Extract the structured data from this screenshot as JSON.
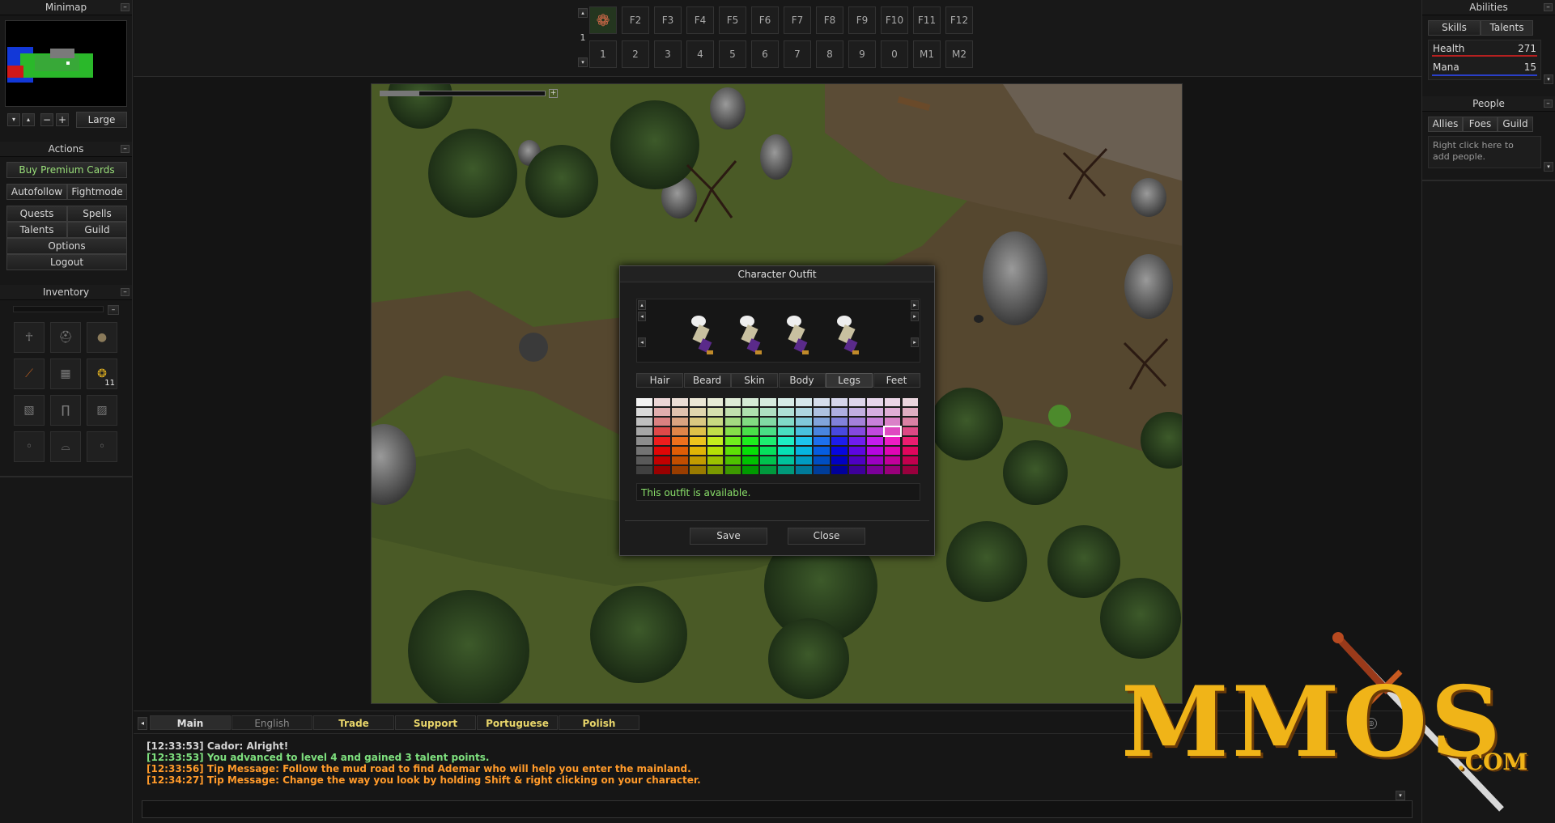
{
  "minimap": {
    "title": "Minimap",
    "size_label": "Large"
  },
  "actions": {
    "title": "Actions",
    "premium": "Buy Premium Cards",
    "autofollow": "Autofollow",
    "fightmode": "Fightmode",
    "quests": "Quests",
    "spells": "Spells",
    "talents": "Talents",
    "guild": "Guild",
    "options": "Options",
    "logout": "Logout"
  },
  "inventory": {
    "title": "Inventory",
    "gold_count": "11"
  },
  "hotbar": {
    "page": "1",
    "fkeys": [
      "F2",
      "F3",
      "F4",
      "F5",
      "F6",
      "F7",
      "F8",
      "F9",
      "F10",
      "F11",
      "F12"
    ],
    "nums": [
      "1",
      "2",
      "3",
      "4",
      "5",
      "6",
      "7",
      "8",
      "9",
      "0",
      "M1",
      "M2"
    ]
  },
  "abilities": {
    "title": "Abilities",
    "tab_skills": "Skills",
    "tab_talents": "Talents",
    "health_label": "Health",
    "health_value": "271",
    "mana_label": "Mana",
    "mana_value": "15",
    "health_color": "#b52020",
    "mana_color": "#2a3fc7"
  },
  "people": {
    "title": "People",
    "tab_allies": "Allies",
    "tab_foes": "Foes",
    "tab_guild": "Guild",
    "hint": "Right click here to add people."
  },
  "outfit": {
    "title": "Character Outfit",
    "tabs": [
      "Hair",
      "Beard",
      "Skin",
      "Body",
      "Legs",
      "Feet"
    ],
    "selected_tab": "Legs",
    "status": "This outfit is available.",
    "save": "Save",
    "close": "Close"
  },
  "chat": {
    "tabs": [
      {
        "label": "Main",
        "color": "#e0e0e0"
      },
      {
        "label": "English",
        "color": "#8a8a8a"
      },
      {
        "label": "Trade",
        "color": "#e8d56a"
      },
      {
        "label": "Support",
        "color": "#e8d56a"
      },
      {
        "label": "Portuguese",
        "color": "#e8d56a"
      },
      {
        "label": "Polish",
        "color": "#e8d56a"
      }
    ],
    "messages": [
      {
        "text": "[12:33:53] Cador: Alright!",
        "color": "#d4d4d4"
      },
      {
        "text": "[12:33:53] You advanced to level 4 and gained 3 talent points.",
        "color": "#7ee07e"
      },
      {
        "text": "[12:33:56] Tip Message: Follow the mud road to find Ademar who will help you enter the mainland.",
        "color": "#ff9a2a"
      },
      {
        "text": "[12:34:27] Tip Message: Change the way you look by holding Shift & right clicking on your character.",
        "color": "#ff9a2a"
      }
    ]
  },
  "watermark": {
    "brand": "MMOS",
    "suffix": ".COM"
  }
}
